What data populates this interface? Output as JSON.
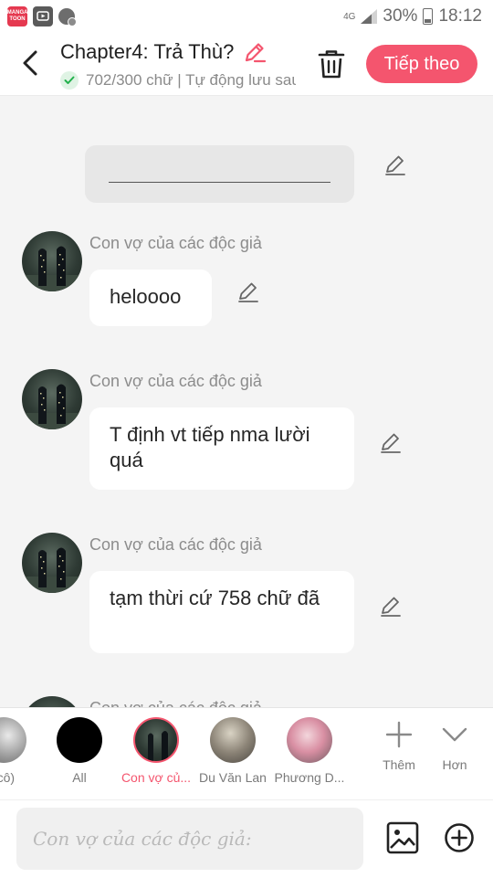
{
  "status_bar": {
    "manga_icon_text": "MANGA TOON",
    "network": "4G",
    "battery": "30%",
    "time": "18:12",
    "icons": [
      "mangatoon-app-icon",
      "tv-app-icon",
      "notification-icon",
      "signal-icon",
      "battery-icon"
    ]
  },
  "header": {
    "title": "Chapter4: Trả Thù?",
    "subtitle": "702/300 chữ | Tự động lưu sau",
    "next_label": "Tiếp theo",
    "accent_color": "#f4556e"
  },
  "messages": [
    {
      "speaker": "Con vợ của các độc giả",
      "text": "heloooo"
    },
    {
      "speaker": "Con vợ của các độc giả",
      "text": "T định vt tiếp nma lười quá"
    },
    {
      "speaker": "Con vợ của các độc giả",
      "text": "tạm thừi cứ 758 chữ đã"
    },
    {
      "speaker": "Con vợ của các độc giả",
      "text": ""
    }
  ],
  "characters": {
    "items": [
      {
        "label": "(cô)",
        "selected": false
      },
      {
        "label": "All",
        "selected": false
      },
      {
        "label": "Con vợ củ...",
        "selected": true
      },
      {
        "label": "Du Văn Lan",
        "selected": false
      },
      {
        "label": "Phương D...",
        "selected": false
      }
    ],
    "add_label": "Thêm",
    "more_label": "Hơn"
  },
  "input": {
    "placeholder": "Con vợ của các độc giả:",
    "value": ""
  }
}
